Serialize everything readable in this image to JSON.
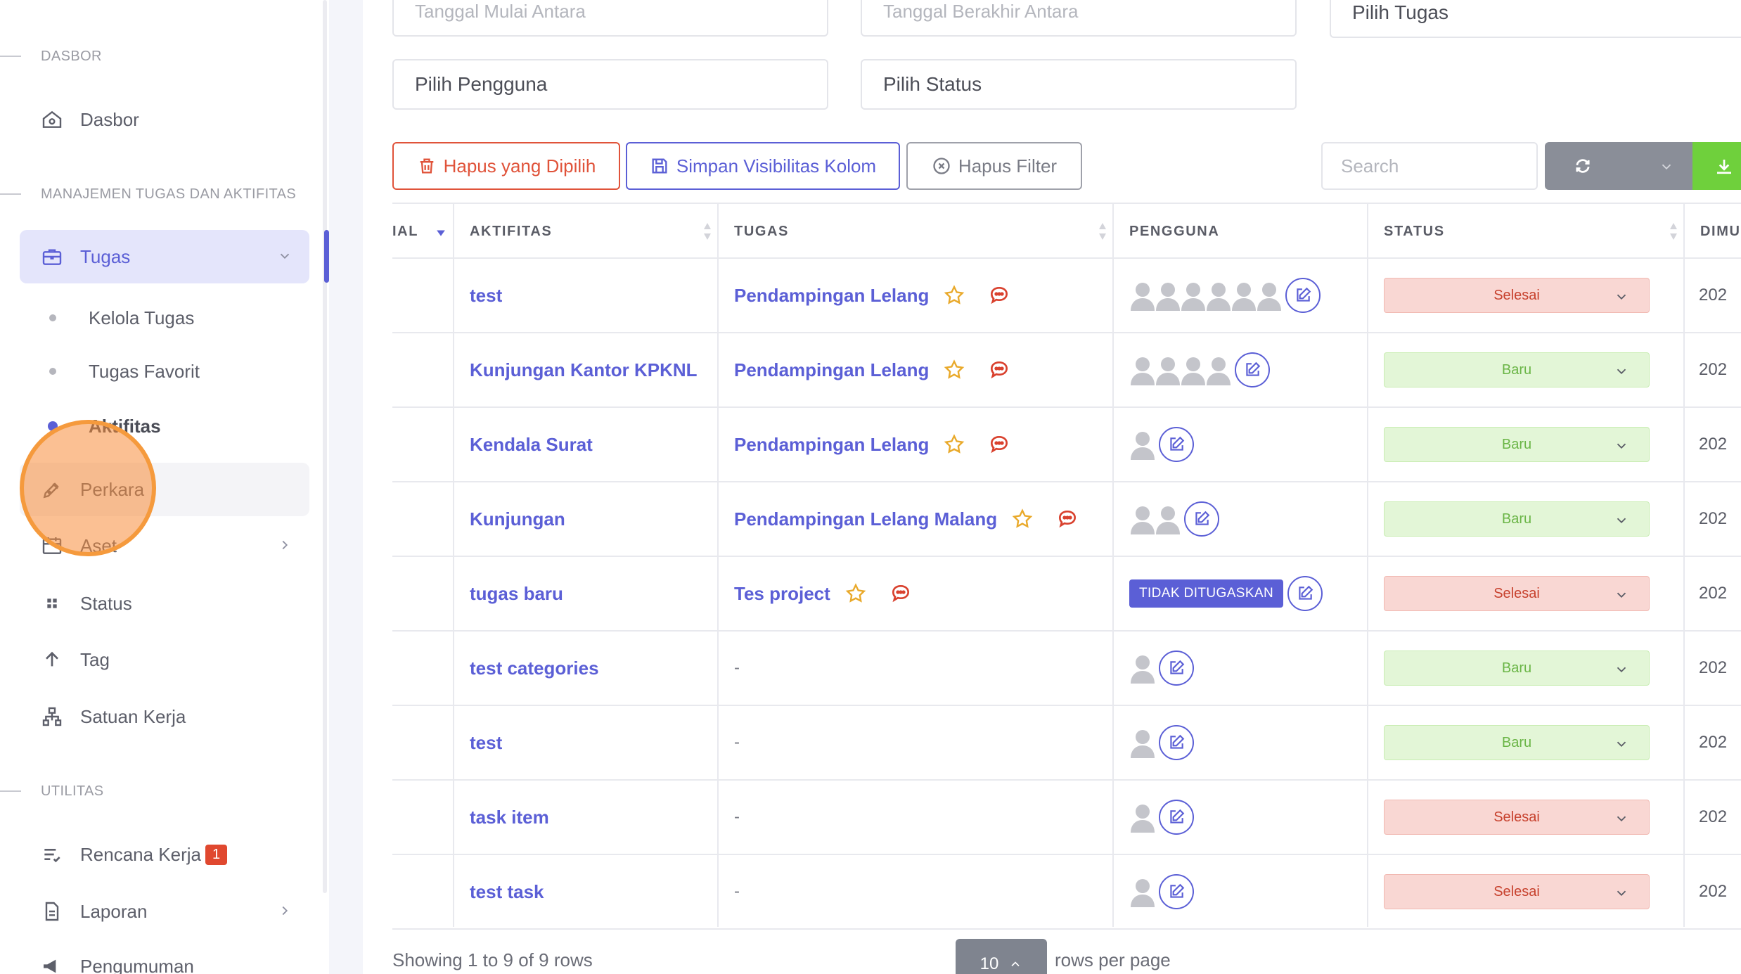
{
  "sidebar": {
    "sections": {
      "dashboard": "DASBOR",
      "task_mgmt": "MANAJEMEN TUGAS DAN AKTIFITAS",
      "utilities": "UTILITAS"
    },
    "items": {
      "dasbor": "Dasbor",
      "tugas": "Tugas",
      "kelola_tugas": "Kelola Tugas",
      "tugas_favorit": "Tugas Favorit",
      "aktifitas": "Aktifitas",
      "perkara": "Perkara",
      "aset": "Aset",
      "status": "Status",
      "tag": "Tag",
      "satuan_kerja": "Satuan Kerja",
      "rencana_kerja": "Rencana Kerja",
      "rencana_kerja_badge": "1",
      "laporan": "Laporan",
      "pengumuman": "Pengumuman"
    }
  },
  "filters": {
    "start_date_placeholder": "Tanggal Mulai Antara",
    "end_date_placeholder": "Tanggal Berakhir Antara",
    "task_select": "Pilih Tugas",
    "user_select": "Pilih Pengguna",
    "status_select": "Pilih Status"
  },
  "toolbar": {
    "delete_selected": "Hapus yang Dipilih",
    "save_visibility": "Simpan Visibilitas Kolom",
    "clear_filter": "Hapus Filter",
    "search_placeholder": "Search"
  },
  "table": {
    "headers": {
      "initial": "IAL",
      "activity": "AKTIFITAS",
      "task": "TUGAS",
      "user": "PENGGUNA",
      "status": "STATUS",
      "created": "DIMU"
    },
    "rows": [
      {
        "activity": "test",
        "task": "Pendampingan Lelang",
        "users": 6,
        "unassigned": "",
        "status": "Selesai",
        "date": "202"
      },
      {
        "activity": "Kunjungan Kantor KPKNL",
        "task": "Pendampingan Lelang",
        "users": 4,
        "unassigned": "",
        "status": "Baru",
        "date": "202"
      },
      {
        "activity": "Kendala Surat",
        "task": "Pendampingan Lelang",
        "users": 1,
        "unassigned": "",
        "status": "Baru",
        "date": "202"
      },
      {
        "activity": "Kunjungan",
        "task": "Pendampingan Lelang Malang",
        "users": 2,
        "unassigned": "",
        "status": "Baru",
        "date": "202"
      },
      {
        "activity": "tugas baru",
        "task": "Tes project",
        "users": 0,
        "unassigned": "TIDAK DITUGASKAN",
        "status": "Selesai",
        "date": "202"
      },
      {
        "activity": "test categories",
        "task": "-",
        "users": 1,
        "unassigned": "",
        "status": "Baru",
        "date": "202"
      },
      {
        "activity": "test",
        "task": "-",
        "users": 1,
        "unassigned": "",
        "status": "Baru",
        "date": "202"
      },
      {
        "activity": "task item",
        "task": "-",
        "users": 1,
        "unassigned": "",
        "status": "Selesai",
        "date": "202"
      },
      {
        "activity": "test task",
        "task": "-",
        "users": 1,
        "unassigned": "",
        "status": "Selesai",
        "date": "202"
      }
    ]
  },
  "footer": {
    "showing": "Showing 1 to 9 of 9 rows",
    "page_size": "10",
    "rows_per_page": "rows per page"
  },
  "colors": {
    "accent": "#5b5fd6",
    "danger": "#e0533a",
    "success": "#6fd03c",
    "click_marker": "#f59a3d"
  }
}
